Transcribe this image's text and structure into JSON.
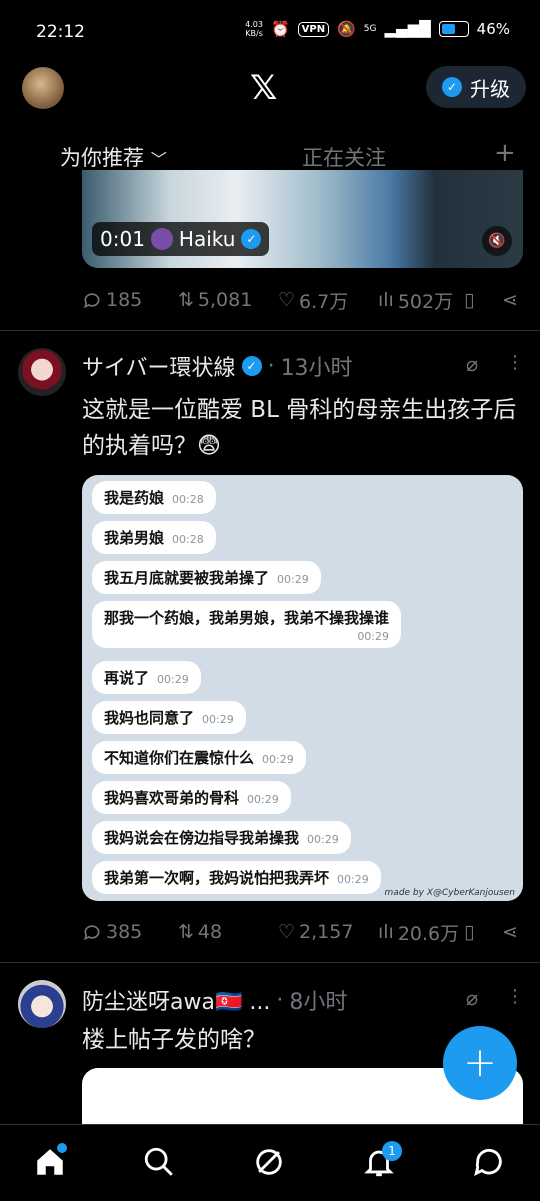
{
  "status_bar": {
    "time": "22:12",
    "net_speed": "4.03",
    "net_unit": "KB/s",
    "vpn": "VPN",
    "signal": "5G",
    "battery": "46%"
  },
  "header": {
    "upgrade_label": "升级"
  },
  "tabs": {
    "for_you": "为你推荐",
    "following": "正在关注"
  },
  "video_tweet": {
    "duration": "0:01",
    "channel": "Haiku",
    "replies": "185",
    "reposts": "5,081",
    "likes": "6.7万",
    "views": "502万"
  },
  "tweet1": {
    "name": "サイバー環状線",
    "time": "13小时",
    "text": "这就是一位酷爱 BL 骨科的母亲生出孩子后的执着吗？😨",
    "replies": "385",
    "reposts": "48",
    "likes": "2,157",
    "views": "20.6万",
    "chat": [
      {
        "text": "我是药娘",
        "time": "00:28"
      },
      {
        "text": "我弟男娘",
        "time": "00:28"
      },
      {
        "text": "我五月底就要被我弟操了",
        "time": "00:29"
      },
      {
        "text": "那我一个药娘，我弟男娘，我弟不操我操谁",
        "time": "00:29"
      },
      {
        "text": "再说了",
        "time": "00:29"
      },
      {
        "text": "我妈也同意了",
        "time": "00:29"
      },
      {
        "text": "不知道你们在震惊什么",
        "time": "00:29"
      },
      {
        "text": "我妈喜欢哥弟的骨科",
        "time": "00:29"
      },
      {
        "text": "我妈说会在傍边指导我弟操我",
        "time": "00:29"
      },
      {
        "text": "我弟第一次啊，我妈说怕把我弄坏",
        "time": "00:29"
      }
    ],
    "watermark": "made by X@CyberKanjousen"
  },
  "tweet2": {
    "name": "防尘迷呀awa🇰🇵 ...",
    "time": "8小时",
    "text": "楼上帖子发的啥？"
  },
  "nav": {
    "notifications_badge": "1"
  },
  "colors": {
    "accent": "#1d9bf0",
    "muted": "#71767b",
    "background": "#000000"
  }
}
